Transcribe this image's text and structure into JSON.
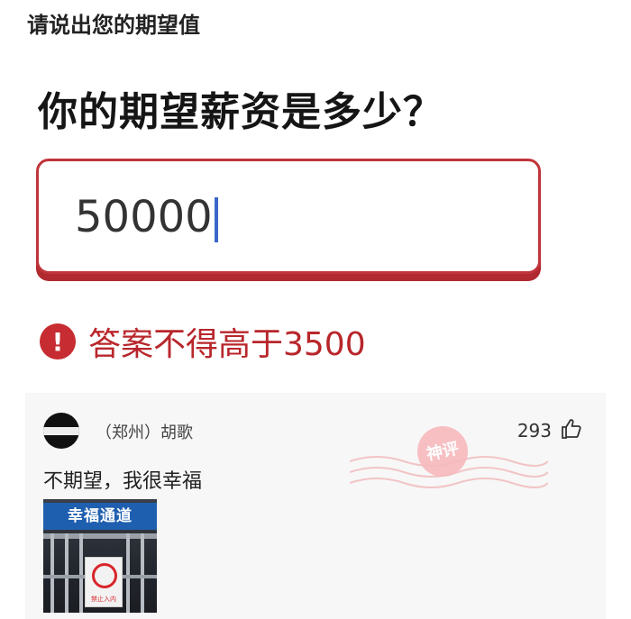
{
  "header": {
    "title": "请说出您的期望值"
  },
  "meme": {
    "question": "你的期望薪资是多少？",
    "input_value": "50000",
    "error_icon_symbol": "!",
    "error_text": "答案不得高于3500",
    "colors": {
      "accent_red": "#c0343a",
      "caret_blue": "#3a66c8"
    }
  },
  "comment": {
    "username": "（郑州）胡歌",
    "likes": "293",
    "text": "不期望，我很幸福",
    "photo": {
      "banner": "幸福通道",
      "sign_text": "禁止入内"
    },
    "stamp_text": "神评"
  },
  "icons": {
    "thumb": "thumbs-up-icon",
    "error": "error-exclamation-icon"
  }
}
